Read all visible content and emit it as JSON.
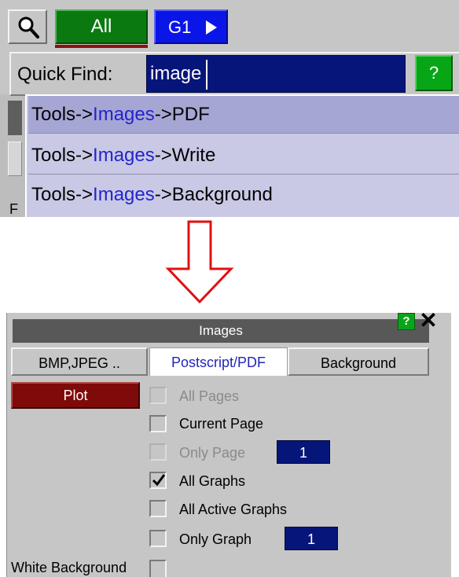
{
  "toolbar": {
    "search_icon": "magnifier-icon",
    "all_label": "All",
    "group_label": "G1",
    "group_arrow_icon": "triangle-right-icon"
  },
  "quick_find": {
    "label": "Quick Find:",
    "value": "image",
    "help_label": "?"
  },
  "side_strip": {
    "letter": "F"
  },
  "suggestions": [
    {
      "prefix": "Tools->",
      "match": "Images",
      "suffix": "->PDF"
    },
    {
      "prefix": "Tools->",
      "match": "Images",
      "suffix": "->Write"
    },
    {
      "prefix": "Tools->",
      "match": "Images",
      "suffix": "->Background"
    }
  ],
  "arrow": {
    "icon": "down-arrow-icon",
    "color": "#e01010"
  },
  "images_dialog": {
    "title": "Images",
    "help_label": "?",
    "close_label": "✕",
    "tabs": [
      "BMP,JPEG ..",
      "Postscript/PDF",
      "Background"
    ],
    "active_tab": "Postscript/PDF",
    "plot_label": "Plot",
    "options": {
      "all_pages": "All Pages",
      "current_page": "Current Page",
      "only_page": "Only Page",
      "only_page_value": "1",
      "all_graphs": "All Graphs",
      "all_active_graphs": "All Active Graphs",
      "only_graph": "Only Graph",
      "only_graph_value": "1"
    },
    "white_background": "White Background"
  },
  "colors": {
    "panel": "#c6c6c6",
    "all_button": "#0a7a10",
    "group_button": "#0a16e8",
    "input_bg": "#06157a",
    "help_green": "#07a617",
    "dropdown": "#c9c9e6",
    "dropdown_selected": "#a6a6d4",
    "match_text": "#2424cc",
    "title_bar": "#585858",
    "plot_button": "#7e0a0a"
  }
}
